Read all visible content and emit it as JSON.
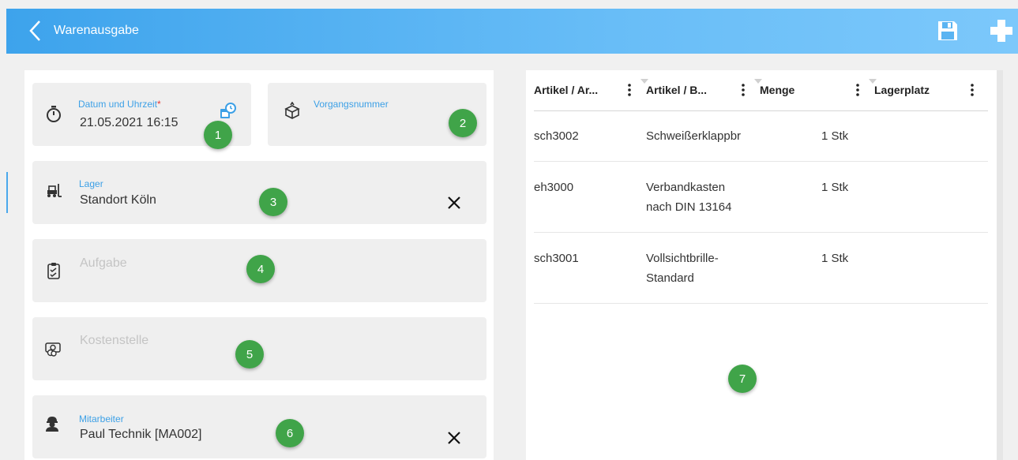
{
  "header": {
    "title": "Warenausgabe",
    "back_icon": "chevron-left-icon",
    "save_icon": "floppy-disk-icon",
    "add_icon": "plus-icon"
  },
  "fields": {
    "datum": {
      "label": "Datum und Uhrzeit",
      "required_mark": "*",
      "value": "21.05.2021 16:15",
      "badge": "1"
    },
    "vorgang": {
      "label": "Vorgangsnummer",
      "value": "",
      "badge": "2"
    },
    "lager": {
      "label": "Lager",
      "value": "Standort Köln",
      "badge": "3"
    },
    "aufgabe": {
      "placeholder": "Aufgabe",
      "badge": "4"
    },
    "kostenstelle": {
      "placeholder": "Kostenstelle",
      "badge": "5"
    },
    "mitarbeiter": {
      "label": "Mitarbeiter",
      "value": "Paul Technik [MA002]",
      "badge": "6"
    }
  },
  "table": {
    "columns": [
      "Artikel / Ar...",
      "Artikel / B...",
      "Menge",
      "Lagerplatz"
    ],
    "rows": [
      {
        "nr": "sch3002",
        "name1": "Schweißerklappbr",
        "name2": "",
        "menge": "1 Stk",
        "lagerplatz": ""
      },
      {
        "nr": "eh3000",
        "name1": "Verbandkasten",
        "name2": "nach DIN 13164",
        "menge": "1 Stk",
        "lagerplatz": ""
      },
      {
        "nr": "sch3001",
        "name1": "Vollsichtbrille-",
        "name2": "Standard",
        "menge": "1 Stk",
        "lagerplatz": ""
      }
    ],
    "badge": "7"
  },
  "colors": {
    "accent": "#3ca0e6",
    "badge": "#40a449",
    "header_start": "#3da3ec",
    "header_end": "#7cc8fb"
  }
}
